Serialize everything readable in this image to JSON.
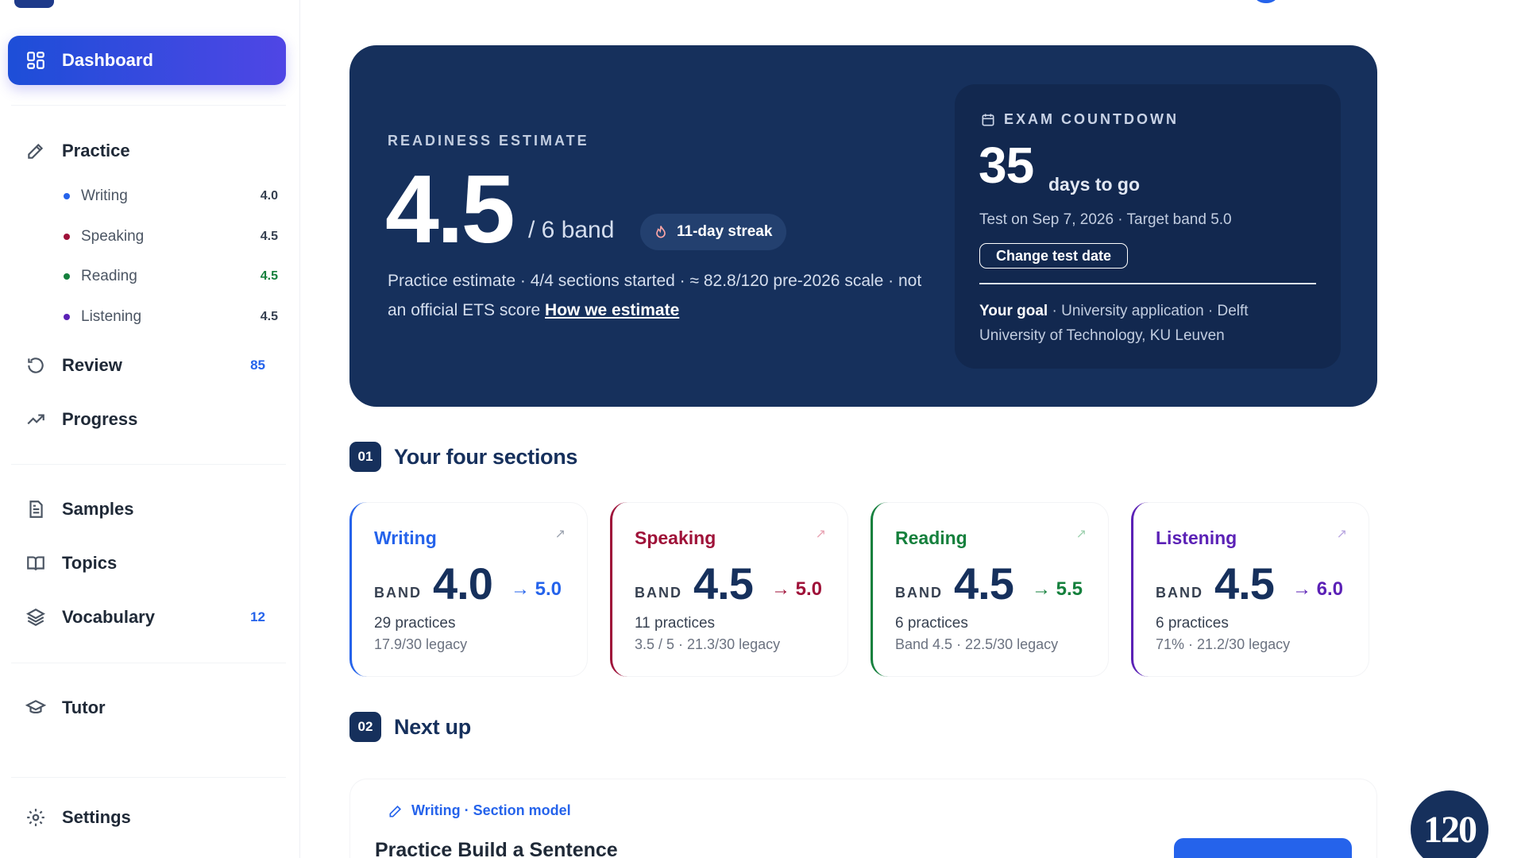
{
  "sidebar": {
    "dashboard": "Dashboard",
    "practice": "Practice",
    "sub": [
      {
        "label": "Writing",
        "score": "4.0",
        "color": "#2563eb"
      },
      {
        "label": "Speaking",
        "score": "4.5",
        "color": "#9f1239"
      },
      {
        "label": "Reading",
        "score": "4.5",
        "color": "#15803d"
      },
      {
        "label": "Listening",
        "score": "4.5",
        "color": "#5b21b6"
      }
    ],
    "review": "Review",
    "review_count": "85",
    "progress": "Progress",
    "samples": "Samples",
    "topics": "Topics",
    "vocabulary": "Vocabulary",
    "vocabulary_count": "12",
    "tutor": "Tutor",
    "settings": "Settings"
  },
  "hero": {
    "label": "READINESS ESTIMATE",
    "score": "4.5",
    "band_of": "/ 6 band",
    "streak": "11-day streak",
    "note": "Practice estimate · 4/4 sections started · ≈ 82.8/120 pre-2026 scale · not an official ETS score",
    "note_link": "How we estimate"
  },
  "countdown": {
    "label": "EXAM COUNTDOWN",
    "days": "35",
    "days_text": "days to go",
    "test_line": "Test on Sep 7, 2026 · Target band 5.0",
    "change_button": "Change test date",
    "goal_label": "Your goal",
    "goal_text": " · University application · Delft University of Technology, KU Leuven"
  },
  "sections": {
    "num": "01",
    "title": "Your four sections",
    "band_label": "BAND",
    "cards": [
      {
        "name": "Writing",
        "score": "4.0",
        "target": "→ 5.0",
        "practices": "29 practices",
        "legacy": "17.9/30 legacy",
        "color": "#2563eb"
      },
      {
        "name": "Speaking",
        "score": "4.5",
        "target": "→ 5.0",
        "practices": "11 practices",
        "legacy": "3.5 / 5 · 21.3/30 legacy",
        "color": "#9f1239"
      },
      {
        "name": "Reading",
        "score": "4.5",
        "target": "→ 5.5",
        "practices": "6 practices",
        "legacy": "Band 4.5 · 22.5/30 legacy",
        "color": "#15803d"
      },
      {
        "name": "Listening",
        "score": "4.5",
        "target": "→ 6.0",
        "practices": "6 practices",
        "legacy": "71% · 21.2/30 legacy",
        "color": "#5b21b6"
      }
    ]
  },
  "next_up": {
    "num": "02",
    "title": "Next up",
    "tag": "Writing · Section model",
    "card_title": "Practice Build a Sentence"
  },
  "badge": "120"
}
